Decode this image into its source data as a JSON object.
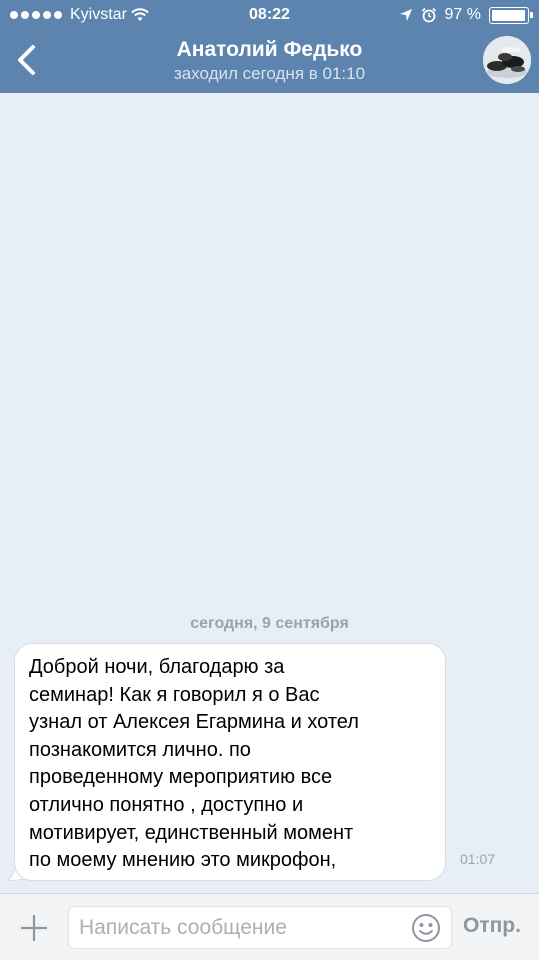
{
  "status_bar": {
    "carrier": "Kyivstar",
    "time": "08:22",
    "battery_label": "97 %",
    "battery_level": 0.97,
    "icons": [
      "signal-dots-icon",
      "wifi-icon",
      "location-arrow-icon",
      "alarm-icon",
      "battery-icon"
    ]
  },
  "header": {
    "contact_name": "Анатолий Федько",
    "last_seen": "заходил сегодня в 01:10",
    "back_icon": "chevron-left-icon",
    "avatar_icon": "avatar"
  },
  "chat": {
    "date_separator": "сегодня, 9 сентября",
    "messages": [
      {
        "lines": [
          "Доброй ночи, благодарю за",
          "семинар!  Как я говорил я о Вас",
          "узнал от Алексея Егармина и хотел",
          "познакомится лично. по",
          "проведенному мероприятию все",
          "отлично понятно , доступно и",
          "мотивирует, единственный момент",
          "по моему мнению это микрофон,"
        ],
        "time": "01:07"
      }
    ]
  },
  "input_bar": {
    "placeholder": "Написать сообщение",
    "value": "",
    "send_label": "Отпр.",
    "attach_icon": "plus-icon",
    "emoji_icon": "smiley-icon"
  },
  "colors": {
    "header_bg": "#5d84ae",
    "chat_bg": "#e8eef5",
    "bubble_bg": "#ffffff",
    "muted_text": "#9aa3ad"
  }
}
